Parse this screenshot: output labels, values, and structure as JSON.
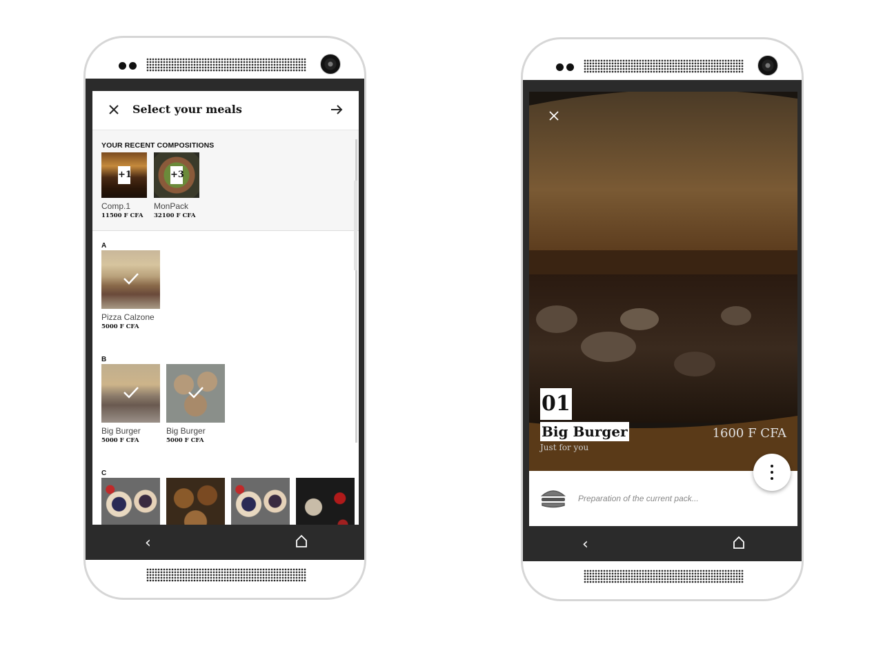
{
  "left_screen": {
    "title": "Select your meals",
    "recent_section_title": "YOUR RECENT COMPOSITIONS",
    "recent": [
      {
        "name": "Comp.1",
        "price": "11500 F CFA",
        "badge": "+1"
      },
      {
        "name": "MonPack",
        "price": "32100 F CFA",
        "badge": "+3"
      }
    ],
    "sections": [
      {
        "letter": "A",
        "items": [
          {
            "name": "Pizza Calzone",
            "price": "5000 F CFA",
            "selected": true
          }
        ]
      },
      {
        "letter": "B",
        "items": [
          {
            "name": "Big Burger",
            "price": "5000 F CFA",
            "selected": true
          },
          {
            "name": "Big Burger",
            "price": "5000 F CFA",
            "selected": true
          }
        ]
      },
      {
        "letter": "C",
        "items": [
          {},
          {},
          {},
          {}
        ]
      }
    ]
  },
  "right_screen": {
    "number": "01",
    "name": "Big Burger",
    "subtitle": "Just for you",
    "price": "1600 F CFA",
    "status": "Preparation of the current pack..."
  },
  "nav": {
    "back_icon": "chevron-left-icon",
    "home_icon": "home-icon"
  },
  "colors": {
    "chrome": "#2b2b2b",
    "accent": "#111111"
  }
}
